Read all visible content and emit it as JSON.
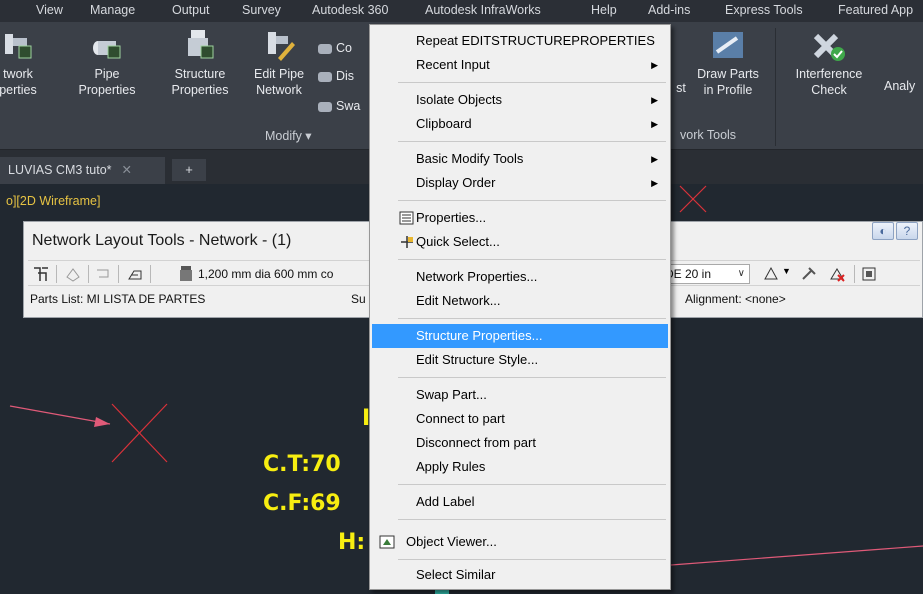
{
  "menubar": {
    "items": [
      "View",
      "Manage",
      "Output",
      "Survey",
      "Autodesk 360",
      "Autodesk InfraWorks",
      "Help",
      "Add-ins",
      "Express Tools",
      "Featured App"
    ]
  },
  "ribbon": {
    "buttons": [
      {
        "label1": "twork",
        "label2": "perties",
        "icon": "network-properties-icon"
      },
      {
        "label1": "Pipe",
        "label2": "Properties",
        "icon": "pipe-properties-icon"
      },
      {
        "label1": "Structure",
        "label2": "Properties",
        "icon": "structure-properties-icon"
      },
      {
        "label1": "Edit Pipe",
        "label2": "Network",
        "icon": "edit-pipe-network-icon"
      }
    ],
    "small_items": [
      "Co",
      "Dis",
      "Swa"
    ],
    "right_buttons": [
      {
        "label1": "Draw Parts",
        "label2": "in Profile",
        "icon": "draw-parts-in-profile-icon"
      },
      {
        "label1": "Interference",
        "label2": "Check",
        "icon": "interference-check-icon"
      },
      {
        "label1": "Analy",
        "label2": "",
        "icon": "analyze-icon"
      }
    ],
    "fragment_st": "st",
    "modify_panel_title": "Modify",
    "network_tools_panel_title": "vork Tools"
  },
  "tabs": {
    "active": "LUVIAS CM3 tuto*",
    "close": "✕",
    "plus": "+"
  },
  "drawing": {
    "view_label": "o][2D Wireframe]",
    "texts": [
      "C.T:70",
      "C.F:69",
      "H:"
    ],
    "text_fragment": "I"
  },
  "palette": {
    "title": "Network Layout Tools - Network - (1)",
    "size_value": "1,200 mm dia 600 mm co",
    "de_value": "DE 20 in",
    "parts_list": "Parts List: MI LISTA DE PARTES",
    "su_fragment": "Su",
    "alignment": "Alignment: <none>",
    "help_button": "?"
  },
  "context_menu": {
    "items": [
      {
        "label": "Repeat EDITSTRUCTUREPROPERTIES",
        "submenu": false
      },
      {
        "label": "Recent Input",
        "submenu": true
      },
      {
        "label": "Isolate Objects",
        "submenu": true
      },
      {
        "label": "Clipboard",
        "submenu": true
      },
      {
        "label": "Basic Modify Tools",
        "submenu": true
      },
      {
        "label": "Display Order",
        "submenu": true
      },
      {
        "label": "Properties...",
        "submenu": false,
        "icon": "properties-icon"
      },
      {
        "label": "Quick Select...",
        "submenu": false,
        "icon": "quick-select-icon"
      },
      {
        "label": "Network Properties...",
        "submenu": false
      },
      {
        "label": "Edit Network...",
        "submenu": false
      },
      {
        "label": "Structure Properties...",
        "submenu": false,
        "highlighted": true
      },
      {
        "label": "Edit Structure Style...",
        "submenu": false
      },
      {
        "label": "Swap Part...",
        "submenu": false
      },
      {
        "label": "Connect to part",
        "submenu": false
      },
      {
        "label": "Disconnect from part",
        "submenu": false
      },
      {
        "label": "Apply Rules",
        "submenu": false
      },
      {
        "label": "Add Label",
        "submenu": false
      },
      {
        "label": "Object Viewer...",
        "submenu": false,
        "icon": "object-viewer-icon"
      },
      {
        "label": "Select Similar",
        "submenu": false
      }
    ],
    "highlight_color": "#3399ff"
  },
  "colors": {
    "ribbon_bg": "#3b4048",
    "drawing_bg": "#212830",
    "cad_text": "#f7ee11",
    "cad_marker": "#d9323a"
  }
}
